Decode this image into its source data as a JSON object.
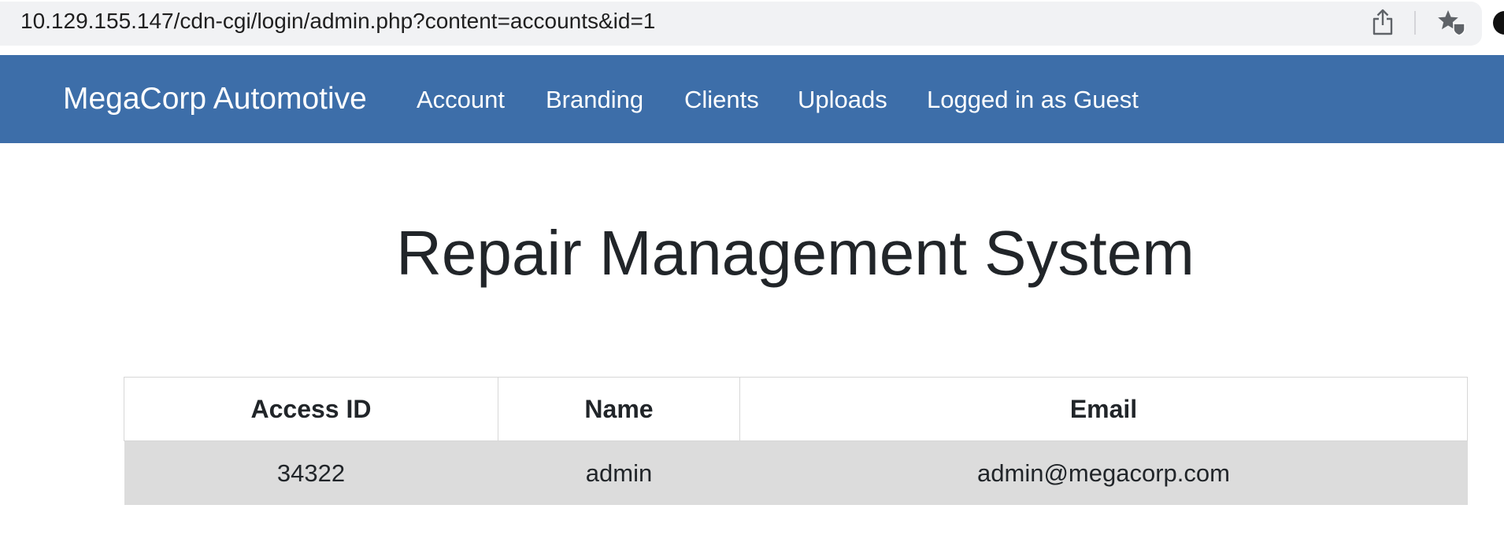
{
  "browser": {
    "url": "10.129.155.147/cdn-cgi/login/admin.php?content=accounts&id=1",
    "share_icon": "share-icon",
    "bookmark_icon": "bookmark-star-icon"
  },
  "navbar": {
    "brand": "MegaCorp Automotive",
    "items": [
      {
        "label": "Account"
      },
      {
        "label": "Branding"
      },
      {
        "label": "Clients"
      },
      {
        "label": "Uploads"
      },
      {
        "label": "Logged in as Guest"
      }
    ],
    "background_color": "#3d6ea9"
  },
  "main": {
    "title": "Repair Management System",
    "table": {
      "columns": [
        "Access ID",
        "Name",
        "Email"
      ],
      "rows": [
        [
          "34322",
          "admin",
          "admin@megacorp.com"
        ]
      ]
    }
  }
}
